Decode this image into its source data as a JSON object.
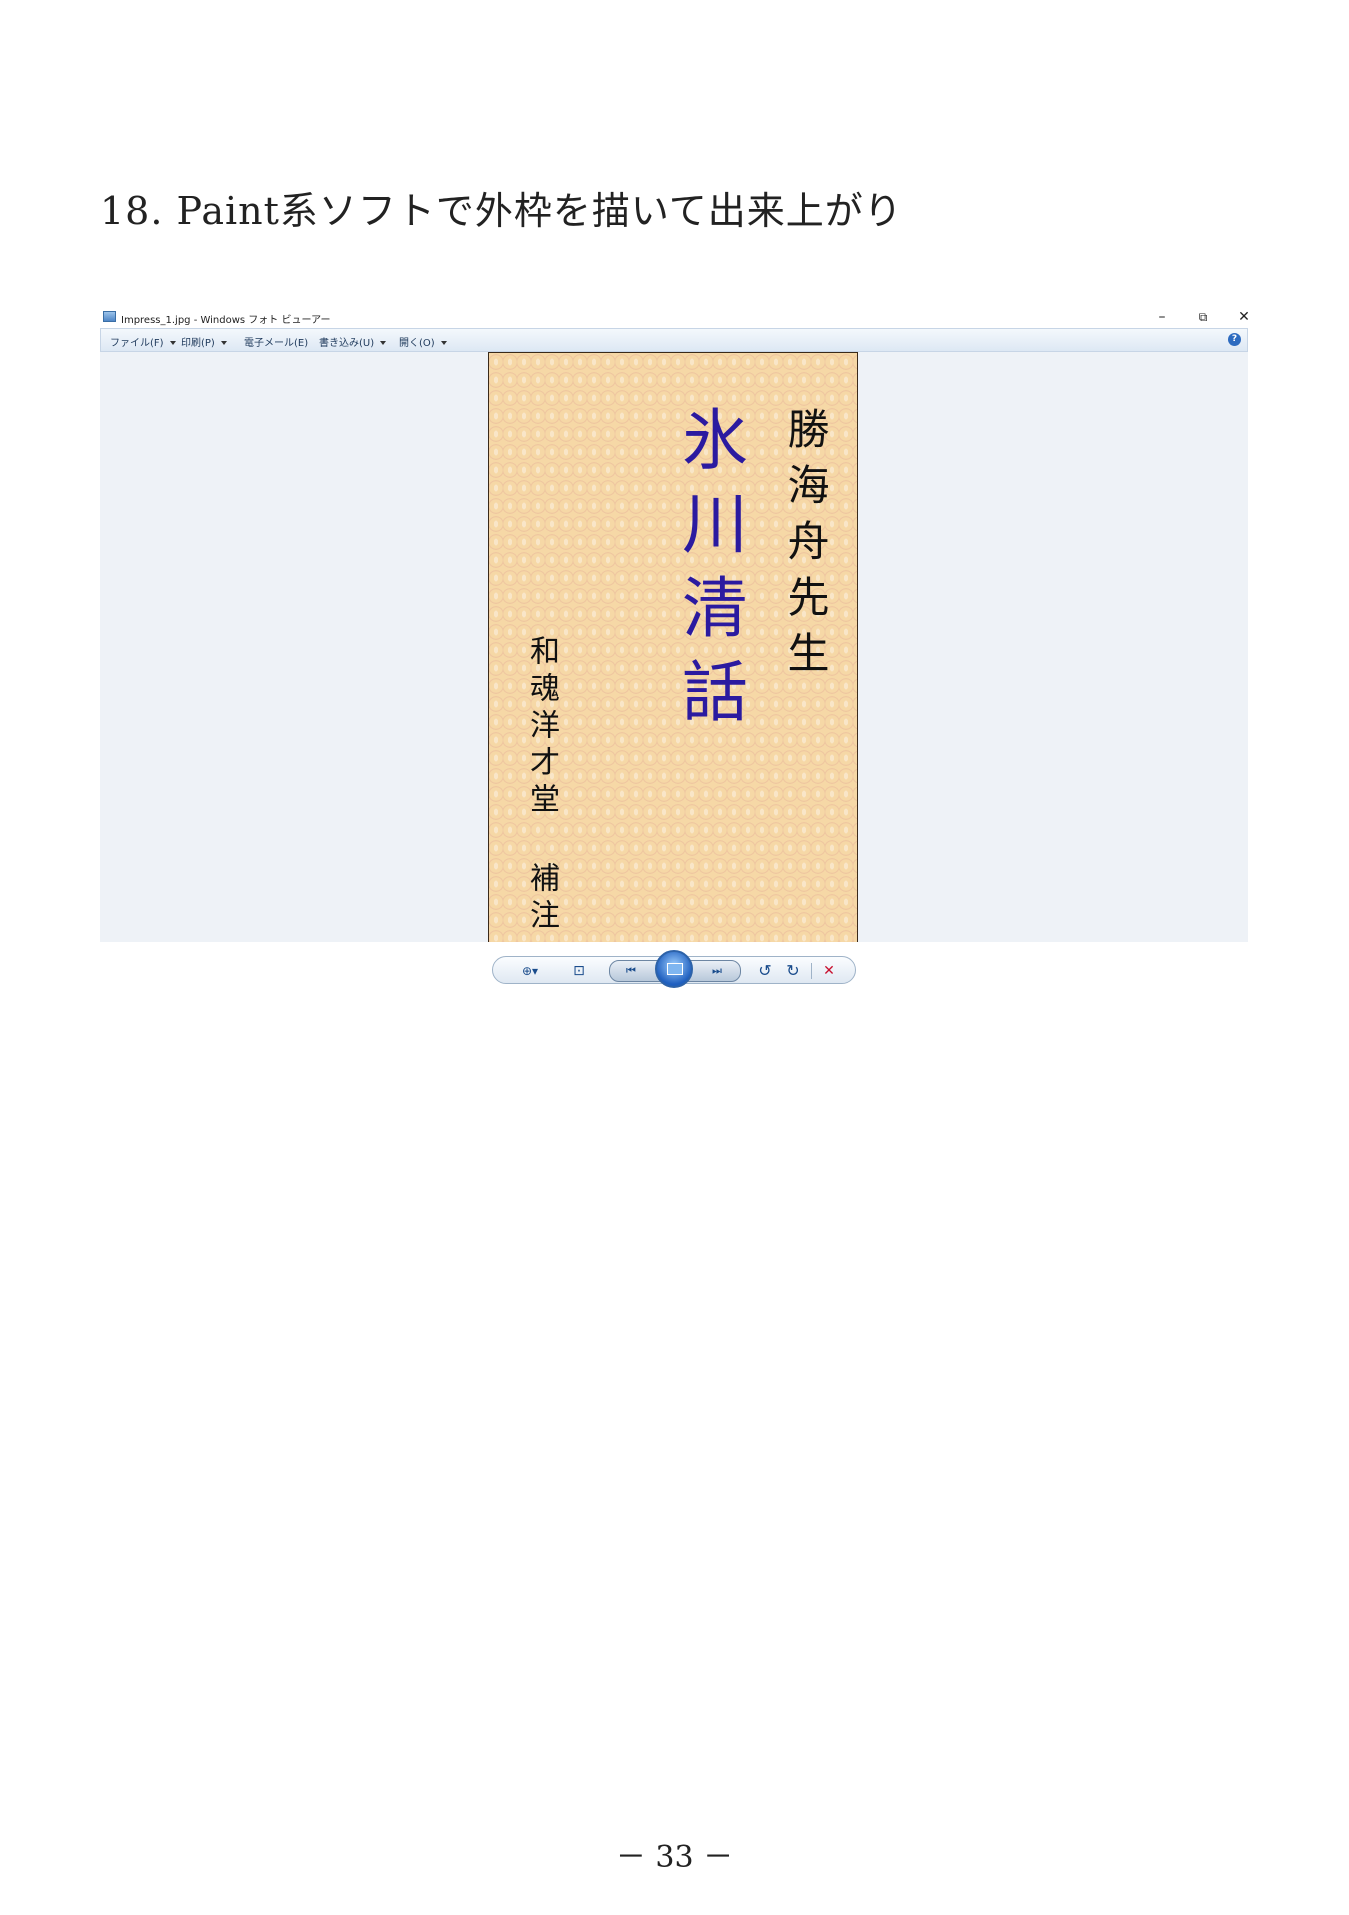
{
  "heading": "18. Paint系ソフトで外枠を描いて出来上がり",
  "window": {
    "title": "Impress_1.jpg - Windows フォト ビューアー",
    "minimize_glyph": "–",
    "restore_glyph": "⧉",
    "close_glyph": "✕"
  },
  "menu": {
    "file": "ファイル(F)",
    "print": "印刷(P)",
    "email": "電子メール(E)",
    "burn": "書き込み(U)",
    "open": "開く(O)",
    "help_glyph": "?"
  },
  "cover": {
    "author": "勝海舟先生",
    "title": "氷川清話",
    "publisher": "和魂洋才堂 補注",
    "colors": {
      "title": "#2b1aa0",
      "background": "#f6d8a6"
    }
  },
  "toolbar": {
    "zoom_glyph": "⊕▾",
    "fit_glyph": "⊡",
    "prev_glyph": "⏮",
    "next_glyph": "⏭",
    "rotate_ccw_glyph": "↺",
    "rotate_cw_glyph": "↻",
    "delete_glyph": "✕",
    "icons": [
      "zoom-icon",
      "actual-size-icon",
      "previous-icon",
      "slideshow-icon",
      "next-icon",
      "rotate-ccw-icon",
      "rotate-cw-icon",
      "delete-icon"
    ]
  },
  "page_number": "－ 33 －"
}
